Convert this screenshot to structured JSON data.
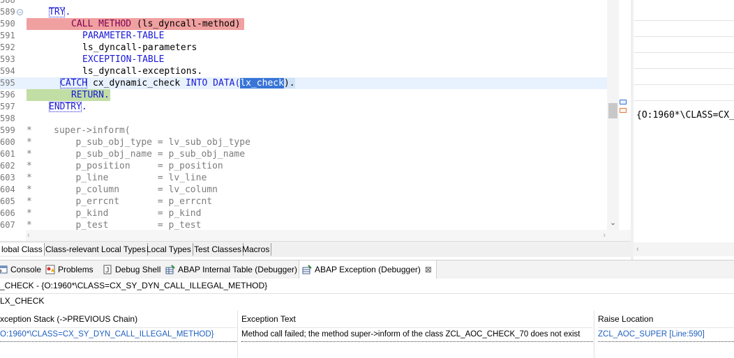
{
  "editor": {
    "lines": [
      {
        "num": "588",
        "text": ""
      },
      {
        "num": "589",
        "text": "TRY."
      },
      {
        "num": "590",
        "text": "CALL METHOD (ls_dyncall-method)"
      },
      {
        "num": "591",
        "text": "PARAMETER-TABLE"
      },
      {
        "num": "592",
        "text": "ls_dyncall-parameters"
      },
      {
        "num": "593",
        "text": "EXCEPTION-TABLE"
      },
      {
        "num": "594",
        "text": "ls_dyncall-exceptions."
      },
      {
        "num": "595",
        "text": "CATCH cx_dynamic_check INTO DATA(lx_check)."
      },
      {
        "num": "596",
        "text": "RETURN."
      },
      {
        "num": "597",
        "text": "ENDTRY."
      },
      {
        "num": "598",
        "text": ""
      },
      {
        "num": "599",
        "text": "*    super->inform("
      },
      {
        "num": "600",
        "text": "*        p_sub_obj_type = lv_sub_obj_type"
      },
      {
        "num": "601",
        "text": "*        p_sub_obj_name = p_sub_obj_name"
      },
      {
        "num": "602",
        "text": "*        p_position     = p_position"
      },
      {
        "num": "603",
        "text": "*        p_line         = lv_line"
      },
      {
        "num": "604",
        "text": "*        p_column       = lv_column"
      },
      {
        "num": "605",
        "text": "*        p_errcnt       = p_errcnt"
      },
      {
        "num": "606",
        "text": "*        p_kind         = p_kind"
      },
      {
        "num": "607",
        "text": "*        p_test         = p_test"
      }
    ],
    "tokens": {
      "try": "TRY",
      "call_method": "CALL METHOD",
      "call_arg": " (ls_dyncall-method)",
      "parameter_table": "PARAMETER-TABLE",
      "ls_params": "ls_dyncall-parameters",
      "exception_table": "EXCEPTION-TABLE",
      "ls_exceptions": "ls_dyncall-exceptions.",
      "catch": "CATCH",
      "catch_class": " cx_dynamic_check ",
      "into_data": "INTO DATA(",
      "lx_check": "lx_check",
      "close_paren": ").",
      "return": "RETURN.",
      "endtry": "ENDTRY",
      "dot": "."
    }
  },
  "editor_tabs": [
    "lobal Class",
    "Class-relevant Local Types",
    "Local Types",
    "Test Classes",
    "Macros"
  ],
  "right_panel": {
    "value": "{O:1960*\\CLASS=CX_"
  },
  "view_tabs": [
    {
      "label": "Console",
      "icon": "console-icon"
    },
    {
      "label": "Problems",
      "icon": "problems-icon"
    },
    {
      "label": "Debug Shell",
      "icon": "debug-shell-icon"
    },
    {
      "label": "ABAP Internal Table (Debugger)",
      "icon": "internal-table-icon"
    },
    {
      "label": "ABAP Exception (Debugger)",
      "icon": "exception-icon",
      "close": "⊠"
    }
  ],
  "exception_view": {
    "title": "_CHECK - {O:1960*\\CLASS=CX_SY_DYN_CALL_ILLEGAL_METHOD}",
    "filter": "LX_CHECK",
    "columns": [
      "xception Stack (->PREVIOUS Chain)",
      "Exception Text",
      "Raise Location"
    ],
    "row": {
      "stack": "O:1960*\\CLASS=CX_SY_DYN_CALL_ILLEGAL_METHOD}",
      "text": "Method call failed; the method super->inform of the class ZCL_AOC_CHECK_70 does not exist",
      "location": "ZCL_AOC_SUPER [Line:590]"
    }
  },
  "colors": {
    "keyword": "#7f0055",
    "link": "#1f5fbf",
    "highlight_red": "#f0a0a0",
    "highlight_green": "#c1dea4"
  }
}
